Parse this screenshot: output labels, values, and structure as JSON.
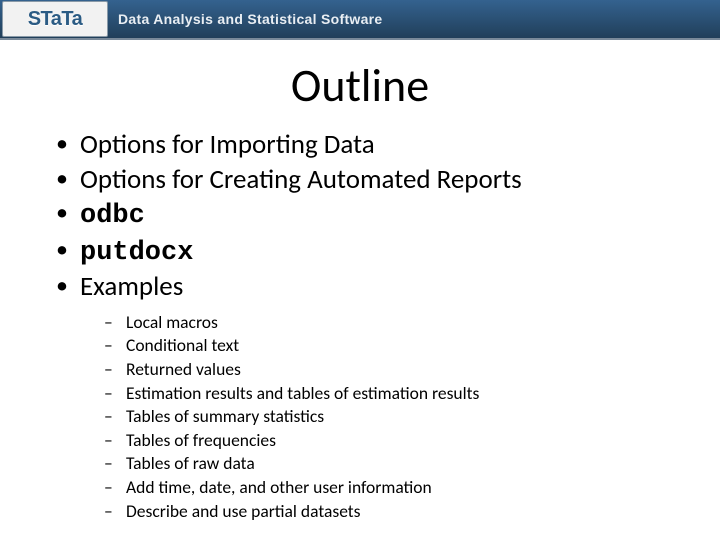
{
  "banner": {
    "logo_main": "STaTa",
    "tagline": "Data Analysis and Statistical Software"
  },
  "title": "Outline",
  "bullets": {
    "b0": "Options for Importing Data",
    "b1": "Options for Creating Automated Reports",
    "b2": "odbc",
    "b3": "putdocx",
    "b4": "Examples"
  },
  "sub": {
    "s0": "Local macros",
    "s1": "Conditional text",
    "s2": "Returned values",
    "s3": "Estimation results and tables of estimation results",
    "s4": "Tables of summary statistics",
    "s5": "Tables of frequencies",
    "s6": "Tables of raw data",
    "s7": "Add time, date, and other user information",
    "s8": "Describe and use partial datasets"
  }
}
